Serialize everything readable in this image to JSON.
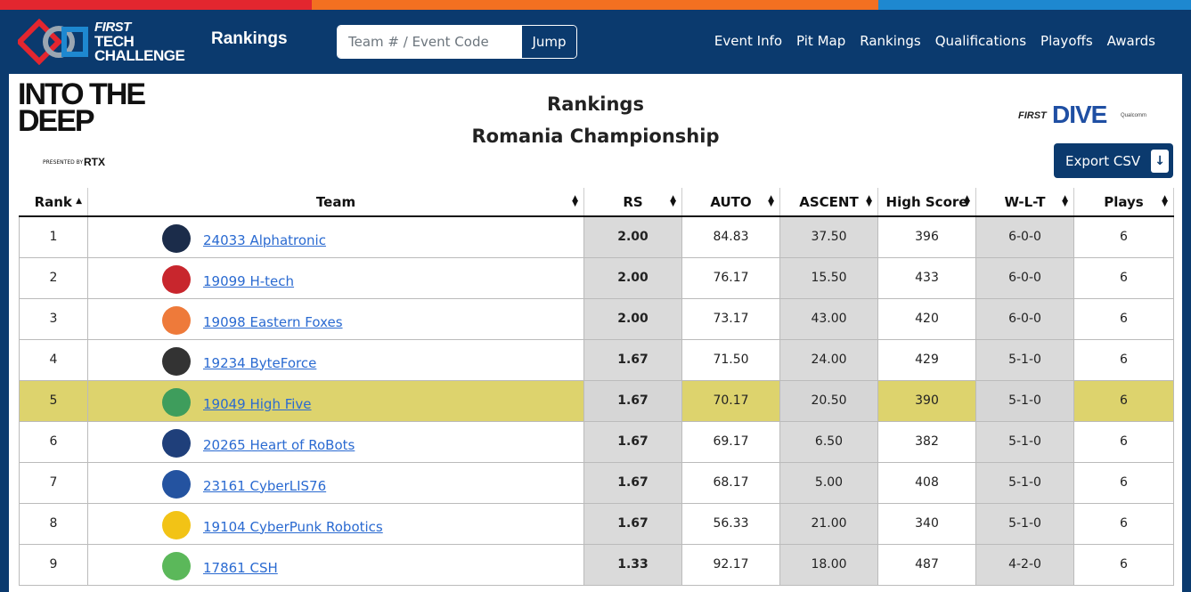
{
  "header": {
    "logo_lines": [
      "FIRST",
      "TECH",
      "CHALLENGE"
    ],
    "title": "Rankings",
    "search_placeholder": "Team # / Event Code",
    "jump_label": "Jump",
    "nav": [
      "Event Info",
      "Pit Map",
      "Rankings",
      "Qualifications",
      "Playoffs",
      "Awards"
    ]
  },
  "season": {
    "logo_lines": [
      "INTO THE",
      "DEEP"
    ],
    "presented_by": "PRESENTED BY",
    "sponsor": "RTX"
  },
  "page": {
    "title": "Rankings",
    "event": "Romania Championship",
    "dive_first": "FIRST",
    "dive_word": "DIVE",
    "dive_sponsor": "Qualcomm",
    "export_label": "Export CSV"
  },
  "colors": {
    "brand": "#0b3a6e",
    "highlight": "#ddd36d",
    "shade": "#dadada",
    "link": "#2a6ad1"
  },
  "table": {
    "columns": [
      "Rank",
      "Team",
      "RS",
      "AUTO",
      "ASCENT",
      "High Score",
      "W-L-T",
      "Plays"
    ],
    "rows": [
      {
        "rank": "1",
        "team": "24033 Alphatronic",
        "rs": "2.00",
        "auto": "84.83",
        "ascent": "37.50",
        "high": "396",
        "wlt": "6-0-0",
        "plays": "6",
        "icon": "wolf-icon",
        "color": "#1b2c4a"
      },
      {
        "rank": "2",
        "team": "19099 H-tech",
        "rs": "2.00",
        "auto": "76.17",
        "ascent": "15.50",
        "high": "433",
        "wlt": "6-0-0",
        "plays": "6",
        "icon": "torii-icon",
        "color": "#c8262d"
      },
      {
        "rank": "3",
        "team": "19098 Eastern Foxes",
        "rs": "2.00",
        "auto": "73.17",
        "ascent": "43.00",
        "high": "420",
        "wlt": "6-0-0",
        "plays": "6",
        "icon": "fox-icon",
        "color": "#ee7a3a"
      },
      {
        "rank": "4",
        "team": "19234 ByteForce",
        "rs": "1.67",
        "auto": "71.50",
        "ascent": "24.00",
        "high": "429",
        "wlt": "5-1-0",
        "plays": "6",
        "icon": "byteforce-icon",
        "color": "#333333"
      },
      {
        "rank": "5",
        "team": "19049 High Five",
        "rs": "1.67",
        "auto": "70.17",
        "ascent": "20.50",
        "high": "390",
        "wlt": "5-1-0",
        "plays": "6",
        "icon": "hand-icon",
        "color": "#3e9d5c"
      },
      {
        "rank": "6",
        "team": "20265 Heart of RoBots",
        "rs": "1.67",
        "auto": "69.17",
        "ascent": "6.50",
        "high": "382",
        "wlt": "5-1-0",
        "plays": "6",
        "icon": "robot-icon",
        "color": "#1f3f7a"
      },
      {
        "rank": "7",
        "team": "23161 CyberLIS76",
        "rs": "1.67",
        "auto": "68.17",
        "ascent": "5.00",
        "high": "408",
        "wlt": "5-1-0",
        "plays": "6",
        "icon": "chain-icon",
        "color": "#2453a0"
      },
      {
        "rank": "8",
        "team": "19104 CyberPunk Robotics",
        "rs": "1.67",
        "auto": "56.33",
        "ascent": "21.00",
        "high": "340",
        "wlt": "5-1-0",
        "plays": "6",
        "icon": "horse-icon",
        "color": "#f2c316"
      },
      {
        "rank": "9",
        "team": "17861 CSH",
        "rs": "1.33",
        "auto": "92.17",
        "ascent": "18.00",
        "high": "487",
        "wlt": "4-2-0",
        "plays": "6",
        "icon": "csh-icon",
        "color": "#5bb85a"
      }
    ],
    "highlight_rank": "5"
  }
}
